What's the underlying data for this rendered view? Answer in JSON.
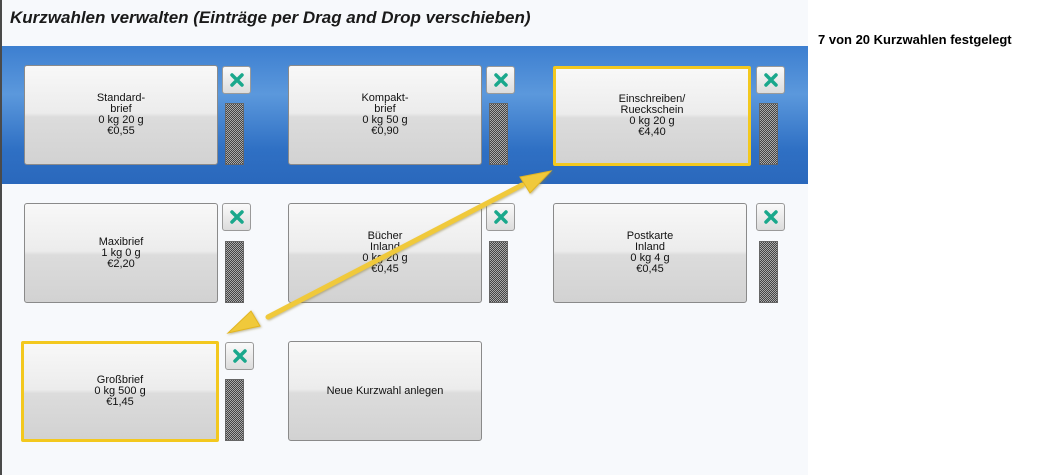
{
  "header": {
    "title": "Kurzwahlen verwalten (Einträge per Drag and Drop verschieben)",
    "count_label": "7 von 20 Kurzwahlen festgelegt"
  },
  "tiles": [
    {
      "lines": [
        "Standard-",
        "brief",
        "0 kg 20 g",
        "€0,55"
      ],
      "selected": false
    },
    {
      "lines": [
        "Kompakt-",
        "brief",
        "0 kg 50 g",
        "€0,90"
      ],
      "selected": false
    },
    {
      "lines": [
        "Einschreiben/",
        "Rueckschein",
        "0 kg 20 g",
        "€4,40"
      ],
      "selected": true
    },
    {
      "lines": [
        "Maxibrief",
        "1 kg 0 g",
        "€2,20"
      ],
      "selected": false
    },
    {
      "lines": [
        "Bücher",
        "Inland",
        "0 kg 20 g",
        "€0,45"
      ],
      "selected": false
    },
    {
      "lines": [
        "Postkarte",
        "Inland",
        "0 kg 4 g",
        "€0,45"
      ],
      "selected": false
    },
    {
      "lines": [
        "Großbrief",
        "0 kg 500 g",
        "€1,45"
      ],
      "selected": true
    }
  ],
  "new_tile_label": "Neue Kurzwahl anlegen",
  "icons": {
    "delete": "delete-x-icon",
    "grip": "drag-grip-handle"
  },
  "colors": {
    "band": "#3d7fd0",
    "selection": "#f3c81e",
    "delete_icon": "#1aa88c",
    "arrow": "#f0c93a"
  }
}
